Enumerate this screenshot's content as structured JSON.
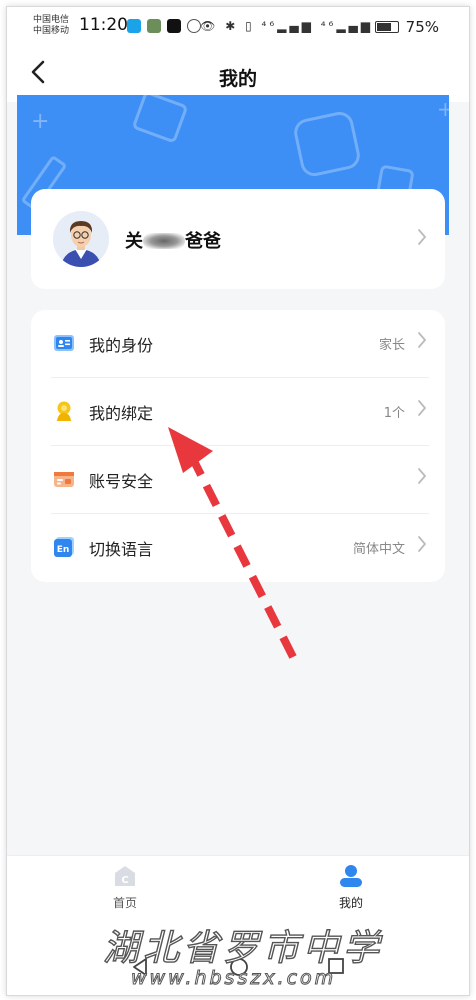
{
  "status_bar": {
    "carrier_1": "中国电信",
    "carrier_2": "中国移动",
    "time": "11:20",
    "signal_1": "⁴⁶",
    "signal_2": "⁴⁶",
    "battery_percent": "75%",
    "battery_level": 0.75
  },
  "header": {
    "back_icon": "chevron-left-icon",
    "title": "我的"
  },
  "profile": {
    "name_prefix": "关",
    "name_suffix": "爸爸",
    "chevron_icon": "chevron-right-icon"
  },
  "menu": {
    "items": [
      {
        "label": "我的身份",
        "value": "家长",
        "icon": "id-card-icon"
      },
      {
        "label": "我的绑定",
        "value": "1个",
        "icon": "binding-person-icon"
      },
      {
        "label": "账号安全",
        "value": "",
        "icon": "account-security-icon"
      },
      {
        "label": "切换语言",
        "value": "简体中文",
        "icon": "language-en-icon"
      }
    ]
  },
  "bottom_nav": {
    "home_label": "首页",
    "mine_label": "我的",
    "active": "我的"
  },
  "watermark": {
    "line1": "湖北省罗市中学",
    "line2": "www.hbsszx.com"
  },
  "colors": {
    "accent": "#3d8ff5",
    "annotation_arrow": "#e8373d",
    "background": "#f5f6f8"
  }
}
